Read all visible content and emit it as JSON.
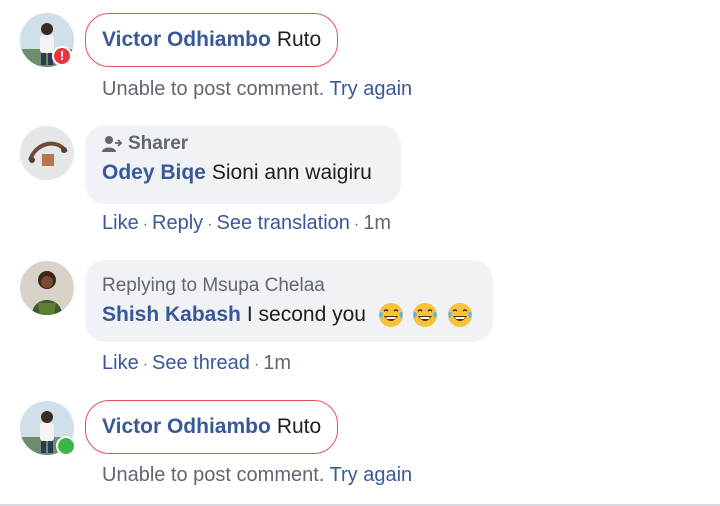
{
  "comments": [
    {
      "author": "Victor Odhiambo",
      "text": "Ruto",
      "error_text": "Unable to post comment.",
      "retry_label": "Try again"
    },
    {
      "badge": "Sharer",
      "author": "Odey Biqe",
      "text": "Sioni ann waigiru",
      "actions": [
        "Like",
        "Reply",
        "See translation"
      ],
      "time": "1m"
    },
    {
      "replying_to": "Replying to Msupa Chelaa",
      "author": "Shish Kabash",
      "text": "I second you",
      "emoji": [
        "tears-of-joy-emoji",
        "tears-of-joy-emoji",
        "tears-of-joy-emoji"
      ],
      "actions": [
        "Like",
        "See thread"
      ],
      "time": "1m"
    },
    {
      "author": "Victor Odhiambo",
      "text": "Ruto",
      "error_text": "Unable to post comment.",
      "retry_label": "Try again"
    }
  ],
  "colors": {
    "link": "#385898",
    "meta": "#606770",
    "bubble": "#f0f2f5",
    "error_border": "#e55159",
    "error_dot": "#e8343f",
    "online_dot": "#3cb54a"
  },
  "status_error_glyph": "!"
}
